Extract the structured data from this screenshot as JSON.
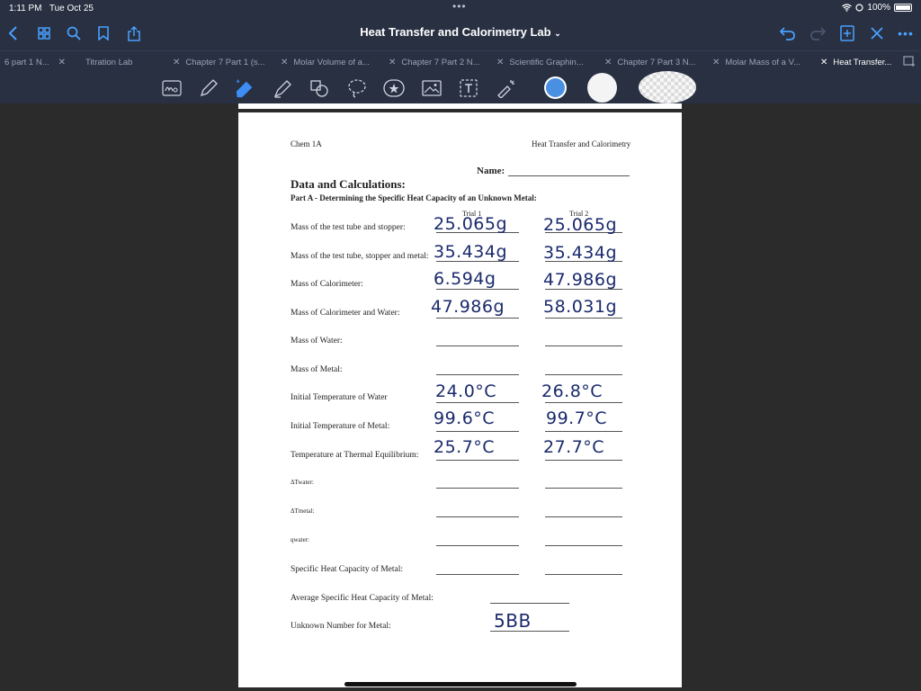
{
  "status": {
    "time": "1:11 PM",
    "date": "Tue Oct 25",
    "dots": "•••",
    "battery": "100%"
  },
  "nav": {
    "title": "Heat Transfer and Calorimetry Lab",
    "more": "•••"
  },
  "tabs": [
    {
      "label": "6 part 1 N..."
    },
    {
      "label": "Titration Lab"
    },
    {
      "label": "Chapter 7 Part 1 (s..."
    },
    {
      "label": "Molar Volume of a..."
    },
    {
      "label": "Chapter 7 Part 2 N..."
    },
    {
      "label": "Scientific Graphin..."
    },
    {
      "label": "Chapter 7 Part 3 N..."
    },
    {
      "label": "Molar Mass of a V..."
    },
    {
      "label": "Heat Transfer..."
    }
  ],
  "toolbar": {
    "colors": [
      "#4a90e2",
      "#ffffff",
      "#ffffff"
    ]
  },
  "document": {
    "header_left": "Chem 1A",
    "header_right": "Heat Transfer and Calorimetry",
    "name_label": "Name:",
    "section_title": "Data and Calculations:",
    "part_title": "Part A - Determining the Specific Heat Capacity of an Unknown Metal:",
    "trial1": "Trial 1",
    "trial2": "Trial 2",
    "rows": [
      {
        "label": "Mass of the test tube and stopper:",
        "t1": "25.065g",
        "t2": "25.065g"
      },
      {
        "label": "Mass of the test tube, stopper and metal:",
        "t1": "35.434g",
        "t2": "35.434g"
      },
      {
        "label": "Mass of Calorimeter:",
        "t1": "6.594g",
        "t2": "47.986g"
      },
      {
        "label": "Mass of Calorimeter and Water:",
        "t1": "47.986g",
        "t2": "58.031g"
      },
      {
        "label": "Mass of Water:",
        "t1": "",
        "t2": ""
      },
      {
        "label": "Mass of Metal:",
        "t1": "",
        "t2": ""
      },
      {
        "label": "Initial Temperature of Water",
        "t1": "24.0°C",
        "t2": "26.8°C"
      },
      {
        "label": "Initial Temperature of Metal:",
        "t1": "99.6°C",
        "t2": "99.7°C"
      },
      {
        "label": "Temperature at Thermal Equilibrium:",
        "t1": "25.7°C",
        "t2": "27.7°C"
      },
      {
        "label": "ΔTwater:",
        "t1": "",
        "t2": ""
      },
      {
        "label": "ΔTmetal:",
        "t1": "",
        "t2": ""
      },
      {
        "label": "qwater:",
        "t1": "",
        "t2": ""
      },
      {
        "label": "Specific Heat Capacity of Metal:",
        "t1": "",
        "t2": ""
      }
    ],
    "avg_label": "Average Specific Heat Capacity of Metal:",
    "unknown_label": "Unknown Number for Metal:",
    "unknown_value": "5BB"
  }
}
